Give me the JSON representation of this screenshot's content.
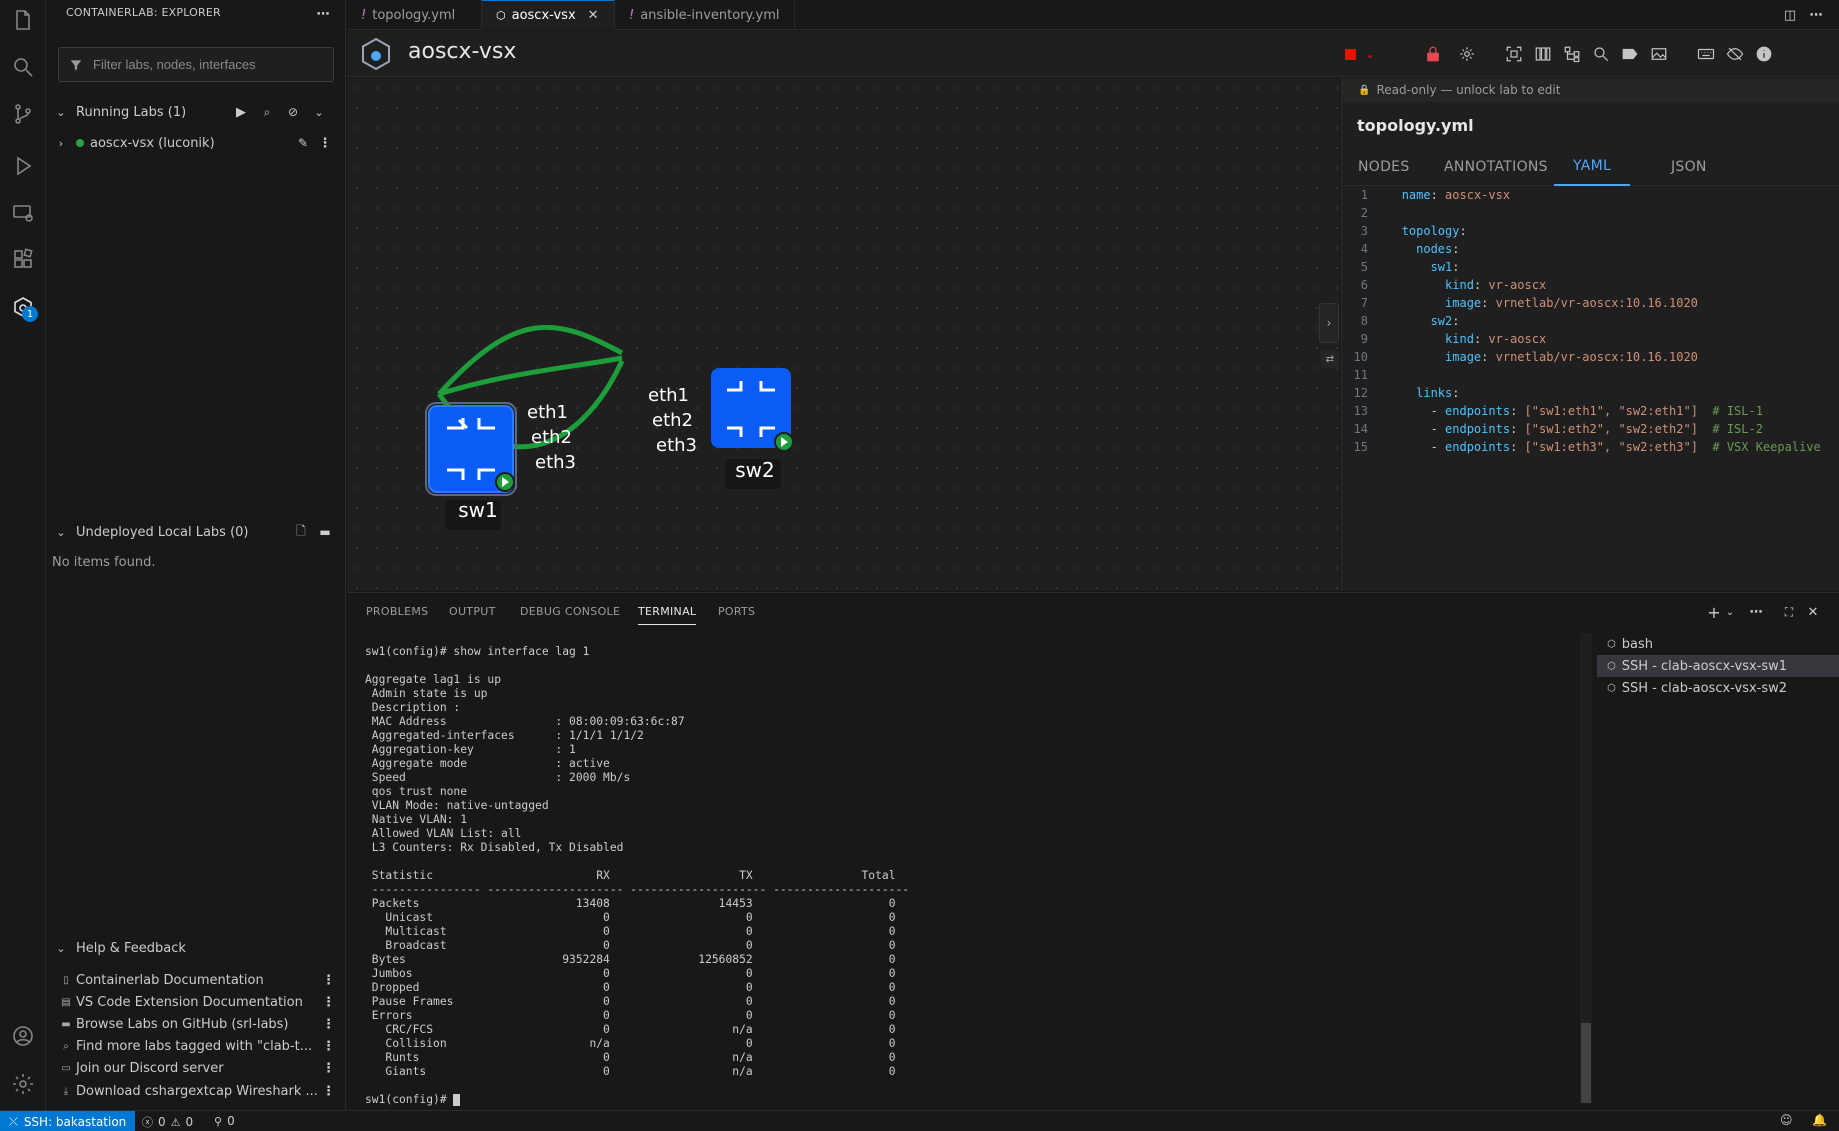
{
  "sidebar": {
    "title": "CONTAINERLAB: EXPLORER",
    "filter_placeholder": "Filter labs, nodes, interfaces",
    "running_labs": {
      "label": "Running Labs (1)",
      "item": "aoscx-vsx (luconik)"
    },
    "undeployed": {
      "label": "Undeployed Local Labs (0)",
      "empty": "No items found."
    },
    "help": {
      "label": "Help & Feedback",
      "items": [
        "Containerlab Documentation",
        "VS Code Extension Documentation",
        "Browse Labs on GitHub (srl-labs)",
        "Find more labs tagged with \"clab-t...",
        "Join our Discord server",
        "Download cshargextcap Wireshark ..."
      ]
    },
    "activity_badge": "1"
  },
  "tabs": [
    {
      "label": "topology.yml"
    },
    {
      "label": "aoscx-vsx"
    },
    {
      "label": "ansible-inventory.yml"
    }
  ],
  "editor": {
    "title": "aoscx-vsx"
  },
  "topology": {
    "nodes": [
      {
        "name": "sw1"
      },
      {
        "name": "sw2"
      }
    ],
    "labels": {
      "sw1_eth1": "eth1",
      "sw1_eth2": "eth2",
      "sw1_eth3": "eth3",
      "sw2_eth1": "eth1",
      "sw2_eth2": "eth2",
      "sw2_eth3": "eth3"
    }
  },
  "right_panel": {
    "readonly_banner": "Read-only — unlock lab to edit",
    "file_title": "topology.yml",
    "tabs": [
      "NODES",
      "ANNOTATIONS",
      "YAML",
      "JSON"
    ],
    "active_tab": "YAML",
    "yaml_lines": [
      "name: aoscx-vsx",
      "",
      "topology:",
      "  nodes:",
      "    sw1:",
      "      kind: vr-aoscx",
      "      image: vrnetlab/vr-aoscx:10.16.1020",
      "    sw2:",
      "      kind: vr-aoscx",
      "      image: vrnetlab/vr-aoscx:10.16.1020",
      "",
      "  links:",
      "    - endpoints: [\"sw1:eth1\", \"sw2:eth1\"]  # ISL-1",
      "    - endpoints: [\"sw1:eth2\", \"sw2:eth2\"]  # ISL-2",
      "    - endpoints: [\"sw1:eth3\", \"sw2:eth3\"]  # VSX Keepalive"
    ]
  },
  "bottom_panel": {
    "tabs": [
      "PROBLEMS",
      "OUTPUT",
      "DEBUG CONSOLE",
      "TERMINAL",
      "PORTS"
    ],
    "active_tab": "TERMINAL",
    "terminal_lines": [
      "sw1(config)# show interface lag 1",
      "",
      "Aggregate lag1 is up",
      " Admin state is up",
      " Description :",
      " MAC Address                : 08:00:09:63:6c:87",
      " Aggregated-interfaces      : 1/1/1 1/1/2",
      " Aggregation-key            : 1",
      " Aggregate mode             : active",
      " Speed                      : 2000 Mb/s",
      " qos trust none",
      " VLAN Mode: native-untagged",
      " Native VLAN: 1",
      " Allowed VLAN List: all",
      " L3 Counters: Rx Disabled, Tx Disabled",
      "",
      " Statistic                        RX                   TX                Total",
      " ---------------- -------------------- -------------------- --------------------",
      " Packets                       13408                14453                    0",
      "   Unicast                         0                    0                    0",
      "   Multicast                       0                    0                    0",
      "   Broadcast                       0                    0                    0",
      " Bytes                       9352284             12560852                    0",
      " Jumbos                            0                    0                    0",
      " Dropped                           0                    0                    0",
      " Pause Frames                      0                    0                    0",
      " Errors                            0                    0                    0",
      "   CRC/FCS                         0                  n/a                    0",
      "   Collision                     n/a                    0                    0",
      "   Runts                           0                  n/a                    0",
      "   Giants                          0                  n/a                    0",
      ""
    ],
    "prompt": "sw1(config)# ",
    "terminals": [
      "bash",
      "SSH - clab-aoscx-vsx-sw1",
      "SSH - clab-aoscx-vsx-sw2"
    ],
    "selected_terminal": 1
  },
  "status": {
    "remote": "SSH: bakastation",
    "errors": "0",
    "warnings": "0",
    "ports": "0"
  },
  "colors": {
    "accent": "#0078d4",
    "node_blue": "#0a5cf5",
    "link_green": "#1e9e3a",
    "stop_red": "#e51400"
  }
}
